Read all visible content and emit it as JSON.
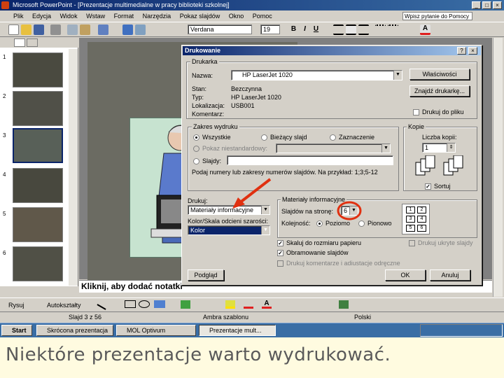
{
  "window": {
    "title": "Microsoft PowerPoint - [Prezentacje multimedialne w pracy biblioteki szkolnej]"
  },
  "menubar": {
    "items": [
      "Plik",
      "Edycja",
      "Widok",
      "Wstaw",
      "Format",
      "Narzędzia",
      "Pokaz slajdów",
      "Okno",
      "Pomoc"
    ],
    "ask_placeholder": "Wpisz pytanie do Pomocy"
  },
  "format_toolbar": {
    "font": "Verdana",
    "size": "19",
    "bold": "B",
    "italic": "I",
    "underline": "U"
  },
  "outline": {
    "slide_numbers": [
      "1",
      "2",
      "3",
      "4",
      "5",
      "6"
    ]
  },
  "notes": {
    "placeholder": "Kliknij, aby dodać notatki"
  },
  "dialog": {
    "title": "Drukowanie",
    "help": "?",
    "close": "×",
    "printer_group": "Drukarka",
    "name_label": "Nazwa:",
    "name_value": "HP LaserJet 1020",
    "status_label": "Stan:",
    "status_value": "Bezczynna",
    "type_label": "Typ:",
    "type_value": "HP LaserJet 1020",
    "location_label": "Lokalizacja:",
    "location_value": "USB001",
    "comment_label": "Komentarz:",
    "comment_value": "",
    "properties_button": "Właściwości",
    "find_printer_button": "Znajdź drukarkę...",
    "print_to_file_label": "Drukuj do pliku",
    "range_group": "Zakres wydruku",
    "range_all": "Wszystkie",
    "range_current": "Bieżący slajd",
    "range_selection": "Zaznaczenie",
    "range_custom_show": "Pokaz niestandardowy:",
    "range_slides": "Slajdy:",
    "range_hint": "Podaj numery lub zakresy numerów slajdów. Na przykład: 1;3;5-12",
    "copies_group": "Kopie",
    "copies_label": "Liczba kopii:",
    "copies_value": "1",
    "collate_label": "Sortuj",
    "print_what_label": "Drukuj:",
    "print_what_value": "Materiały informacyjne",
    "color_label": "Kolor/Skala odcieni szarości:",
    "color_value": "Kolor",
    "handouts_group": "Materiały informacyjne",
    "slides_per_page_label": "Slajdów na stronę:",
    "slides_per_page_value": "6",
    "order_label": "Kolejność:",
    "order_horizontal": "Poziomo",
    "order_vertical": "Pionowo",
    "handout_preview": [
      "1",
      "2",
      "3",
      "4",
      "5",
      "6"
    ],
    "scale_to_fit_label": "Skaluj do rozmiaru papieru",
    "frame_slides_label": "Obramowanie slajdów",
    "print_comments_label": "Drukuj komentarze i adiustacje odręczne",
    "hidden_slides_label": "Drukuj ukryte slajdy",
    "preview_button": "Podgląd",
    "ok_button": "OK",
    "cancel_button": "Anuluj"
  },
  "drawbar": {
    "draw_label": "Rysuj",
    "autoshapes_label": "Autokształty"
  },
  "statusbar": {
    "slide_info": "Slajd 3 z 56",
    "design": "Ambra szablonu",
    "language": "Polski"
  },
  "taskbar": {
    "start": "Start",
    "tasks": [
      "Skrócona prezentacja",
      "MOL Optivum",
      "Prezentacje mult..."
    ]
  },
  "caption": {
    "text": "Niektóre prezentacje warto wydrukować."
  },
  "colors": {
    "titlebar": "#0a246a",
    "annotation_red": "#e03010",
    "caption": "#5a5a5a"
  }
}
